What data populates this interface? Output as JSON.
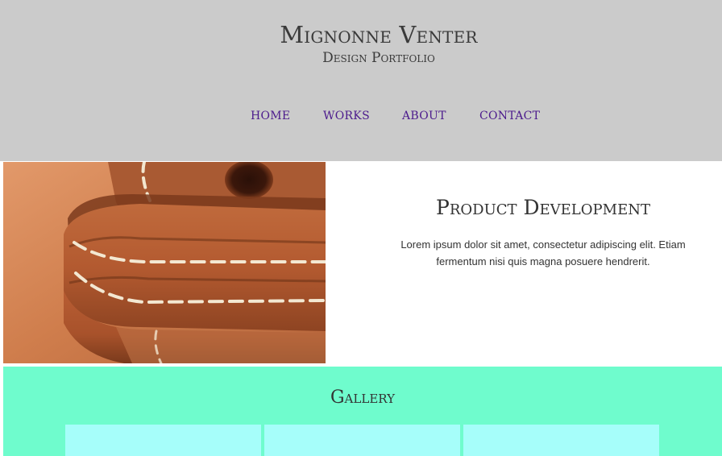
{
  "header": {
    "title": "Mignonne Venter",
    "subtitle": "Design Portfolio",
    "background": "#cbcbcb"
  },
  "nav": {
    "color": "#4b1a8c",
    "items": [
      {
        "label": "HOME"
      },
      {
        "label": "WORKS"
      },
      {
        "label": "ABOUT"
      },
      {
        "label": "CONTACT"
      }
    ]
  },
  "hero": {
    "image": "leather-strap-stitching-photo",
    "heading": "Product Development",
    "body": "Lorem ipsum dolor sit amet, consectetur adipiscing elit. Etiam fermentum nisi quis magna posuere hendrerit."
  },
  "gallery": {
    "title": "Gallery",
    "background": "#6ffccd",
    "tile_color": "#a6fefa"
  }
}
